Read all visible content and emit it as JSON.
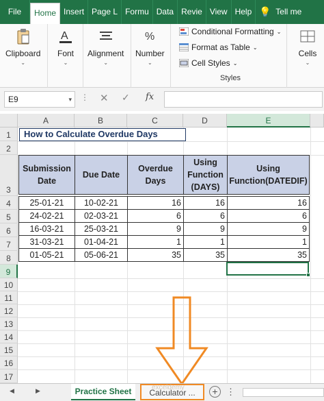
{
  "ribbon_tabs": [
    "File",
    "Home",
    "Insert",
    "Page L",
    "Formu",
    "Data",
    "Revie",
    "View",
    "Help",
    "💡",
    "Tell me"
  ],
  "ribbon": {
    "clipboard": "Clipboard",
    "font": "Font",
    "alignment": "Alignment",
    "number": "Number",
    "conditional_formatting": "Conditional Formatting",
    "format_as_table": "Format as Table",
    "cell_styles": "Cell Styles",
    "styles_group": "Styles",
    "cells": "Cells"
  },
  "formula_bar": {
    "name_box": "E9",
    "fx": "fx",
    "formula": ""
  },
  "columns": [
    "A",
    "B",
    "C",
    "D",
    "E"
  ],
  "rows": [
    "1",
    "2",
    "3",
    "4",
    "5",
    "6",
    "7",
    "8",
    "9",
    "10",
    "11",
    "12",
    "13",
    "14",
    "15",
    "16",
    "17"
  ],
  "sheet_title": "How to Calculate Overdue Days",
  "table": {
    "headers": [
      "Submission Date",
      "Due Date",
      "Overdue Days",
      "Using Function (DAYS)",
      "Using Function(DATEDIF)"
    ],
    "rows": [
      [
        "25-01-21",
        "10-02-21",
        "16",
        "16",
        "16"
      ],
      [
        "24-02-21",
        "02-03-21",
        "6",
        "6",
        "6"
      ],
      [
        "16-03-21",
        "25-03-21",
        "9",
        "9",
        "9"
      ],
      [
        "31-03-21",
        "01-04-21",
        "1",
        "1",
        "1"
      ],
      [
        "01-05-21",
        "05-06-21",
        "35",
        "35",
        "35"
      ]
    ]
  },
  "sheet_tabs": {
    "active": "Practice Sheet",
    "other": "Calculator ..."
  },
  "watermark": "exceldemy",
  "colors": {
    "excel_green": "#217346",
    "header_fill": "#c9d1e6",
    "arrow": "#f08a24",
    "title_border": "#1f3864"
  }
}
